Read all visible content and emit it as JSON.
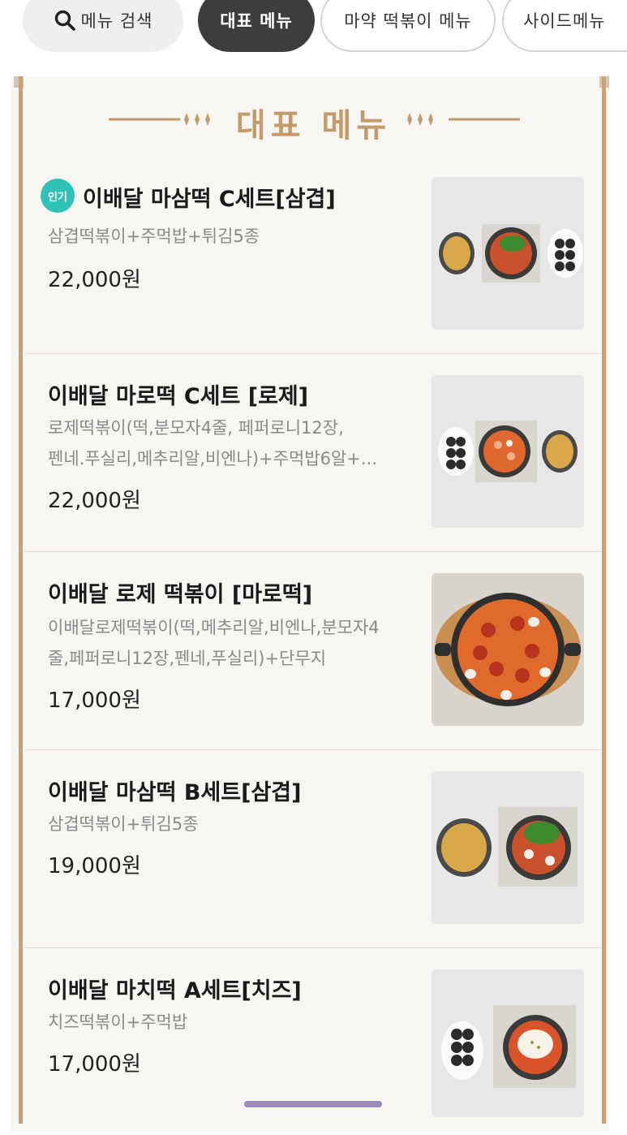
{
  "tabs": [
    {
      "label": "메뉴 검색",
      "icon": "search-icon"
    },
    {
      "label": "대표 메뉴",
      "active": true
    },
    {
      "label": "마약 떡볶이 메뉴"
    },
    {
      "label": "사이드메뉴"
    }
  ],
  "section": {
    "title": "대표 메뉴"
  },
  "items": [
    {
      "badge": "인기",
      "name": "이배달 마삼떡 C세트[삼겹]",
      "desc_lines": [
        "삼겹떡볶이+주먹밥+튀김5종"
      ],
      "price": "22,000원"
    },
    {
      "name": "이배달 마로떡 C세트 [로제]",
      "desc_lines": [
        "로제떡볶이(떡,분모자4줄, 페퍼로니12장,",
        "펜네.푸실리,메추리알,비엔나)+주먹밥6알+..."
      ],
      "price": "22,000원"
    },
    {
      "name": "이배달 로제 떡볶이 [마로떡]",
      "desc_lines": [
        "이배달로제떡볶이(떡,메추리알,비엔나,분모자4",
        "줄,페퍼로니12장,펜네,푸실리)+단무지"
      ],
      "price": "17,000원"
    },
    {
      "name": "이배달 마삼떡 B세트[삼겹]",
      "desc_lines": [
        "삼겹떡볶이+튀김5종"
      ],
      "price": "19,000원"
    },
    {
      "name": "이배달 마치떡 A세트[치즈]",
      "desc_lines": [
        "치즈떡볶이+주먹밥"
      ],
      "price": "17,000원"
    }
  ],
  "colors": {
    "accent_gold": "#c59a6a",
    "active_tab": "#3d3d3d",
    "badge": "#2fc2b8",
    "home_indicator": "#9b8ab8"
  }
}
